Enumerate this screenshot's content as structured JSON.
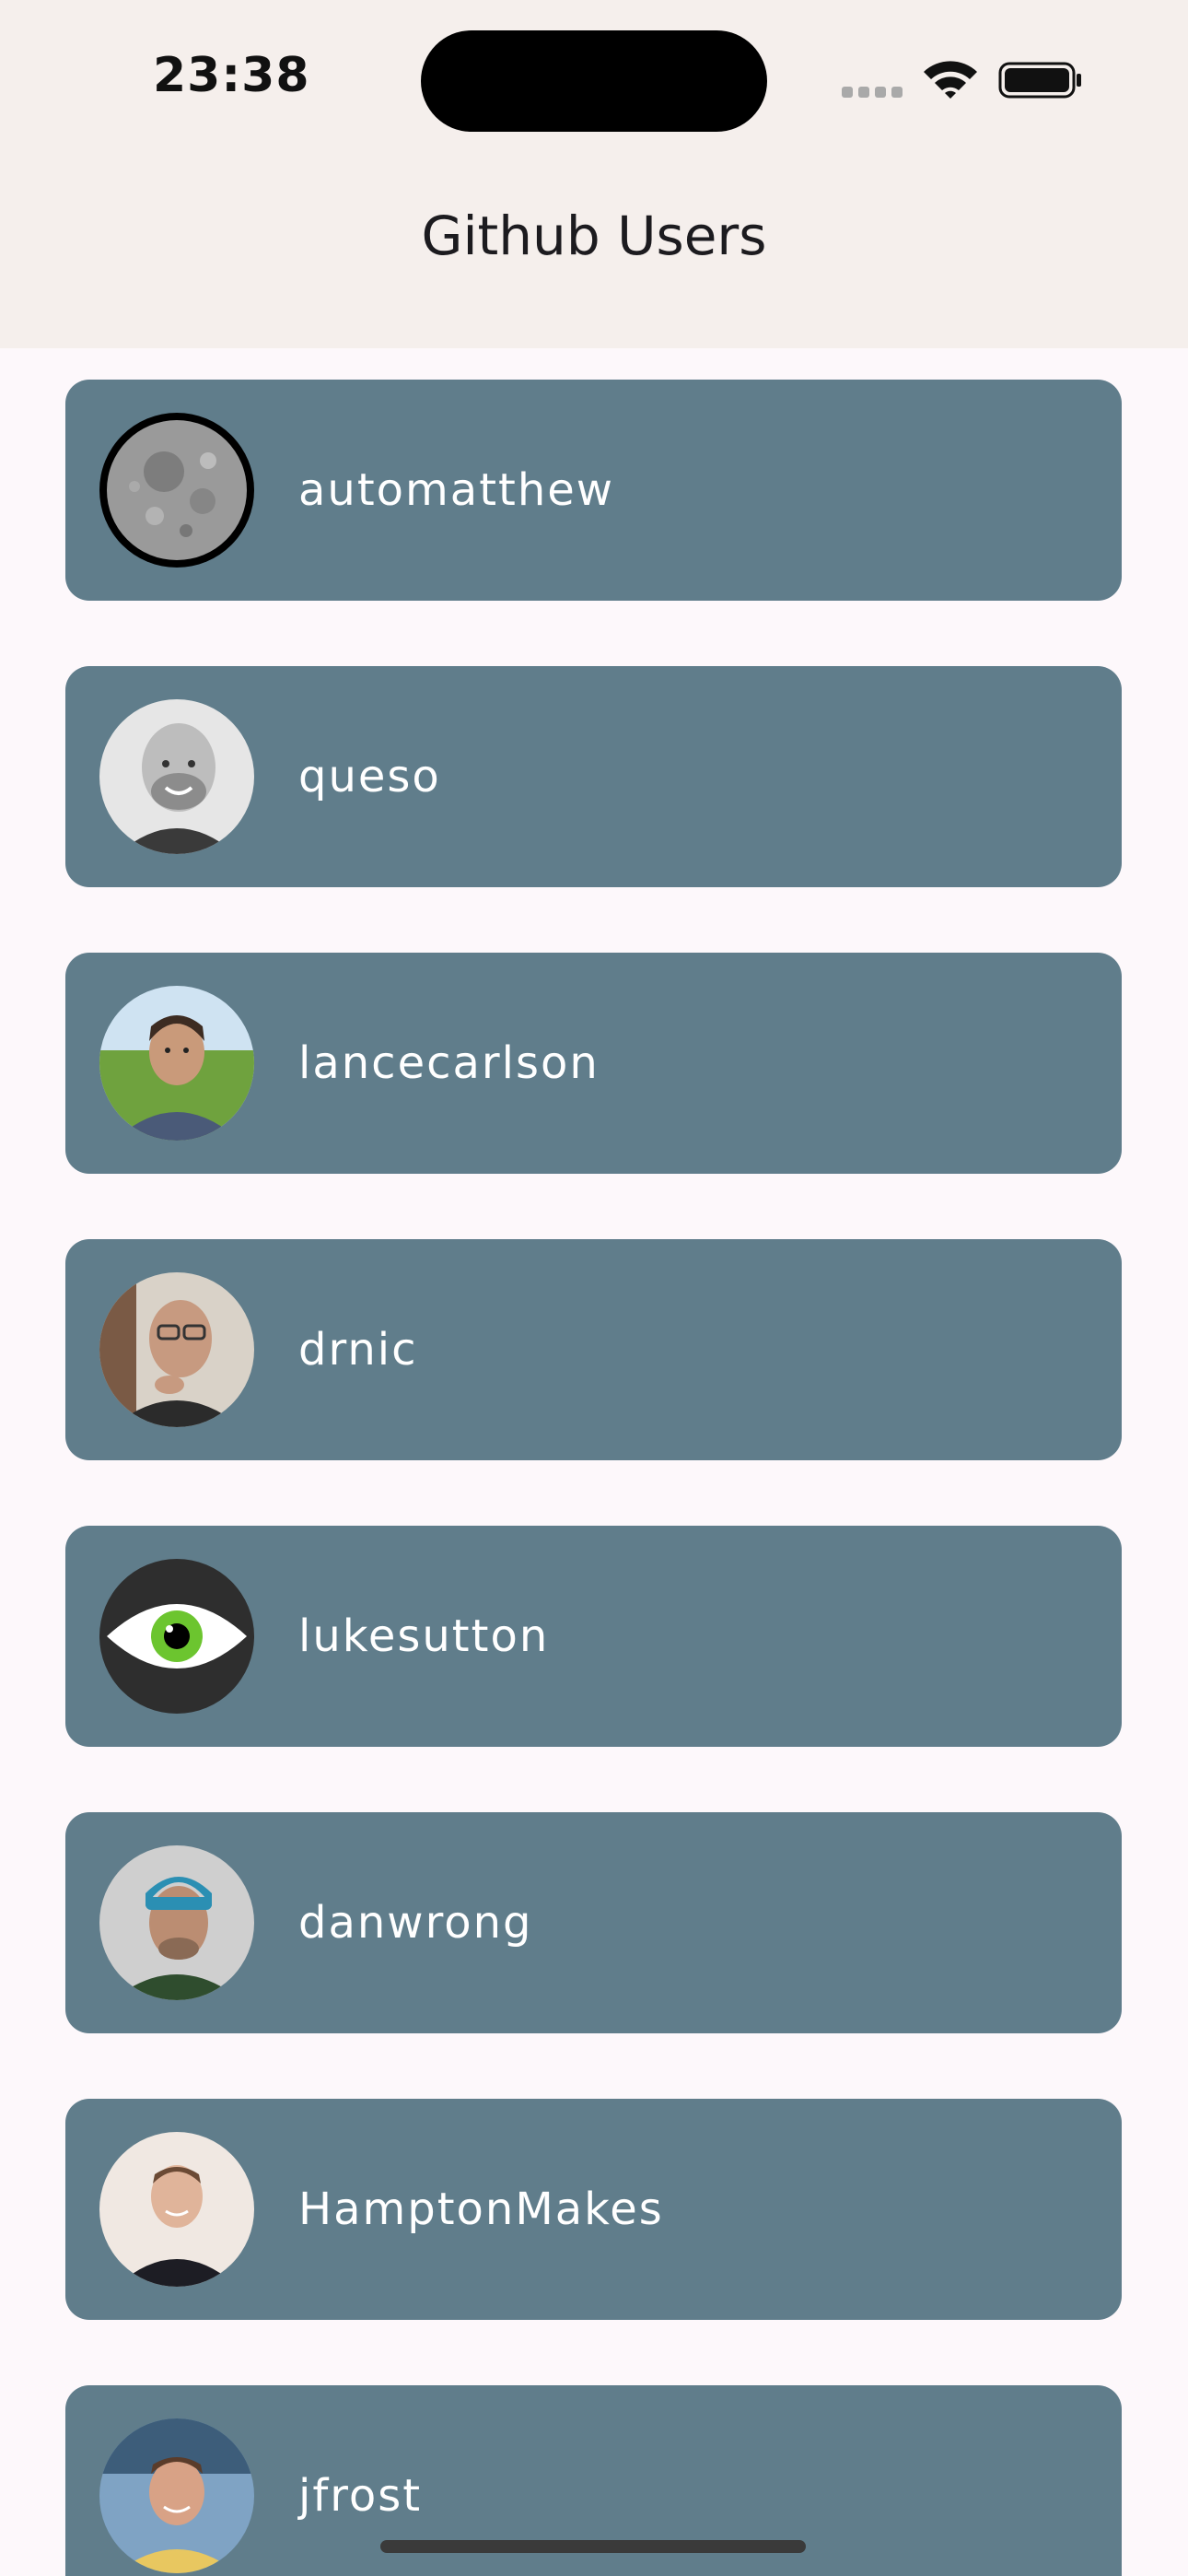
{
  "status_bar": {
    "time": "23:38",
    "icons": [
      "cellular-signal-icon",
      "wifi-icon",
      "battery-icon"
    ]
  },
  "app_bar": {
    "title": "Github Users"
  },
  "users": [
    {
      "login": "automatthew",
      "avatar": "moon-avatar-photo"
    },
    {
      "login": "queso",
      "avatar": "bald-man-bw-avatar-photo"
    },
    {
      "login": "lancecarlson",
      "avatar": "man-outdoors-avatar-photo"
    },
    {
      "login": "drnic",
      "avatar": "man-glasses-avatar-photo"
    },
    {
      "login": "lukesutton",
      "avatar": "green-eye-avatar-icon"
    },
    {
      "login": "danwrong",
      "avatar": "man-beanie-avatar-photo"
    },
    {
      "login": "HamptonMakes",
      "avatar": "man-black-sweater-avatar-photo"
    },
    {
      "login": "jfrost",
      "avatar": "man-yellow-shirt-avatar-photo"
    }
  ],
  "colors": {
    "card": "#607d8b",
    "app_bar": "#f5efec",
    "background": "#fdf8fb",
    "text_on_card": "#ffffff",
    "title_text": "#1c1b1f"
  }
}
